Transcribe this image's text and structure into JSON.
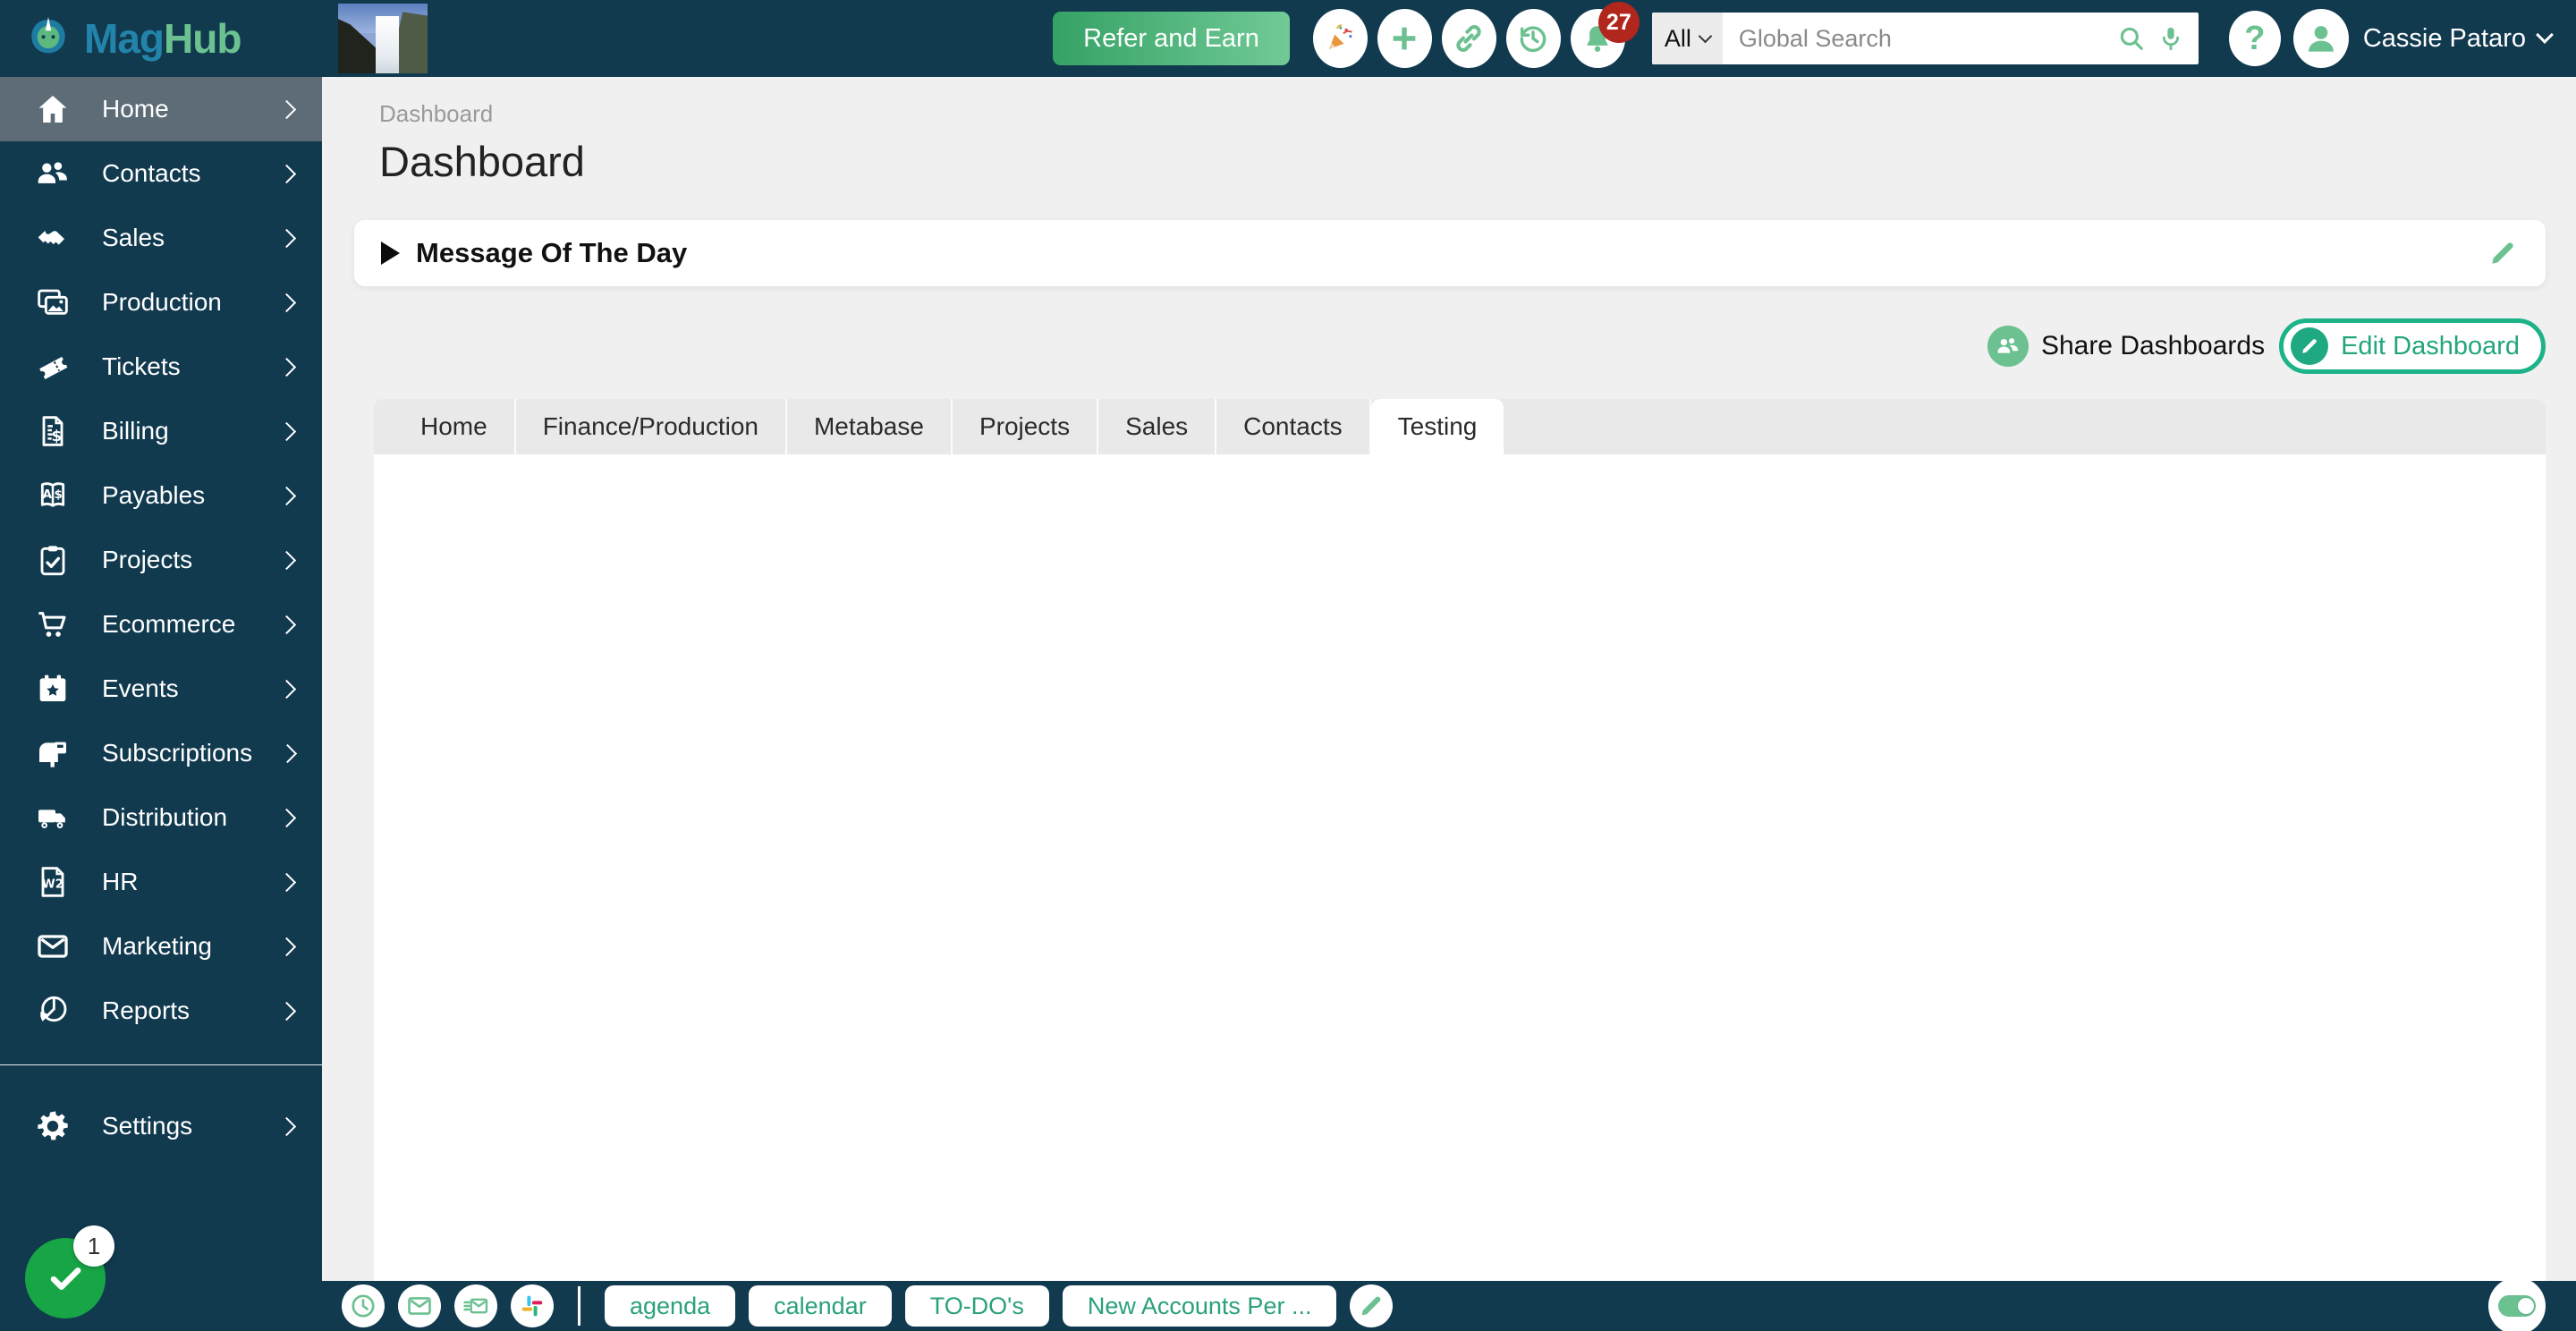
{
  "brand": {
    "name_primary": "Mag",
    "name_secondary": "Hub"
  },
  "sidebar": {
    "items": [
      {
        "label": "Home"
      },
      {
        "label": "Contacts"
      },
      {
        "label": "Sales"
      },
      {
        "label": "Production"
      },
      {
        "label": "Tickets"
      },
      {
        "label": "Billing"
      },
      {
        "label": "Payables"
      },
      {
        "label": "Projects"
      },
      {
        "label": "Ecommerce"
      },
      {
        "label": "Events"
      },
      {
        "label": "Subscriptions"
      },
      {
        "label": "Distribution"
      },
      {
        "label": "HR"
      },
      {
        "label": "Marketing"
      },
      {
        "label": "Reports"
      }
    ],
    "settings_label": "Settings",
    "fab_badge_count": "1"
  },
  "topbar": {
    "refer_button": "Refer and Earn",
    "notification_count": "27",
    "search_scope": "All",
    "search_placeholder": "Global Search",
    "help_label": "?",
    "user_name": "Cassie Pataro"
  },
  "page": {
    "breadcrumb": "Dashboard",
    "title": "Dashboard"
  },
  "motd": {
    "title": "Message Of The Day"
  },
  "dashboard_actions": {
    "share_label": "Share Dashboards",
    "edit_label": "Edit Dashboard"
  },
  "tabs": [
    {
      "label": "Home"
    },
    {
      "label": "Finance/Production"
    },
    {
      "label": "Metabase"
    },
    {
      "label": "Projects"
    },
    {
      "label": "Sales"
    },
    {
      "label": "Contacts"
    },
    {
      "label": "Testing",
      "active": true
    }
  ],
  "bottombar": {
    "buttons": [
      "agenda",
      "calendar",
      "TO-DO's",
      "New Accounts Per ..."
    ]
  },
  "colors": {
    "navy": "#113a4f",
    "accent_green": "#6cc191",
    "teal_green": "#2aa07c",
    "bright_green": "#17a546",
    "badge_red": "#b1261d",
    "brand_blue": "#2383ab",
    "active_item_gray": "#5d6c77"
  }
}
